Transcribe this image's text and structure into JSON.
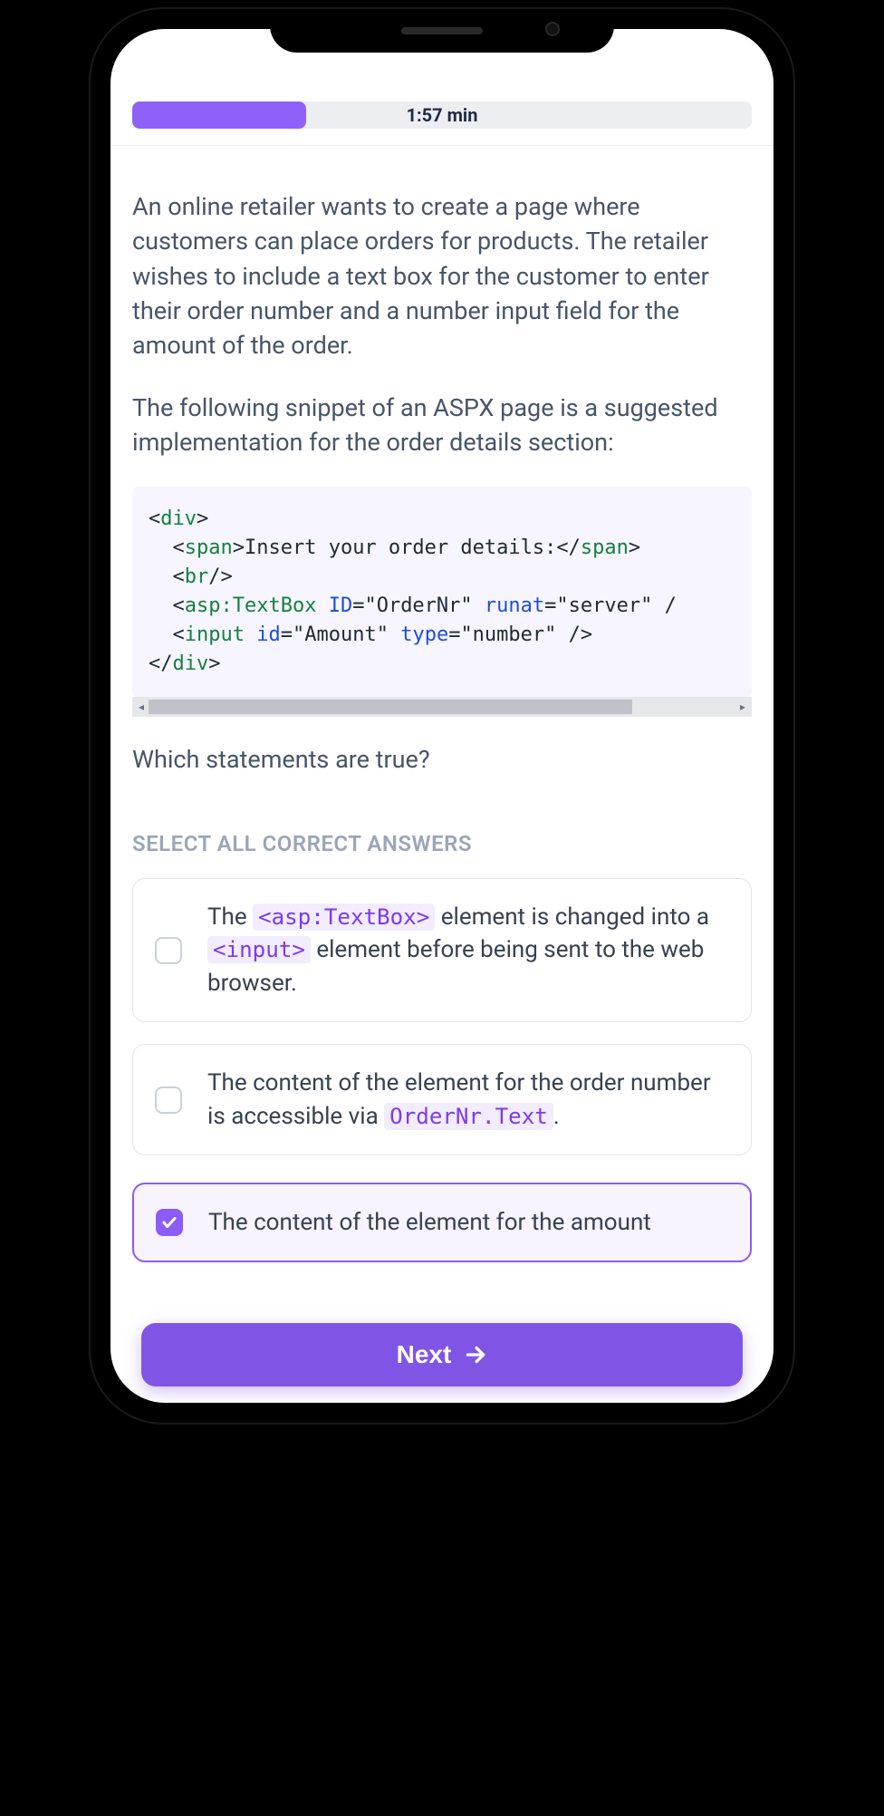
{
  "timer": {
    "label": "1:57 min",
    "progress_percent": 28
  },
  "question": {
    "para1": "An online retailer wants to create a page where customers can place orders for products. The retailer wishes to include a text box for the customer to enter their order number and a number input field for the amount of the order.",
    "para2": "The following snippet of an ASPX page is a suggested implementation for the order details section:",
    "para3": "Which statements are true?"
  },
  "code": {
    "l1a": "div",
    "l2_tag": "span",
    "l2_txt": "Insert your order details:",
    "l3_tag": "br",
    "l4_tag": "asp:TextBox",
    "l4_attr1": "ID",
    "l4_val1": "\"OrderNr\"",
    "l4_attr2": "runat",
    "l4_val2": "\"server\"",
    "l5_tag": "input",
    "l5_attr1": "id",
    "l5_val1": "\"Amount\"",
    "l5_attr2": "type",
    "l5_val2": "\"number\""
  },
  "instruction": "SELECT ALL CORRECT ANSWERS",
  "options": {
    "o1_pre": "The ",
    "o1_code1": "<asp:TextBox>",
    "o1_mid": " element is changed into a ",
    "o1_code2": "<input>",
    "o1_post": " element before being sent to the web browser.",
    "o2_pre": "The content of the element for the order number is accessible via ",
    "o2_code": "OrderNr.Text",
    "o2_post": ".",
    "o3_partial": "The content of the element for the amount"
  },
  "next_label": "Next"
}
